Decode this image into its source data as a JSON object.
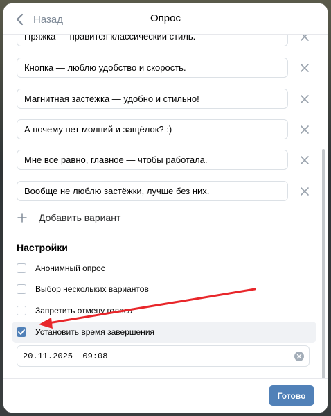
{
  "header": {
    "back_label": "Назад",
    "title": "Опрос"
  },
  "options": [
    "Пряжка — нравится классический стиль.",
    "Кнопка — люблю удобство и скорость.",
    "Магнитная застёжка — удобно и стильно!",
    "А почему нет молний и защёлок? :)",
    "Мне все равно, главное — чтобы работала.",
    "Вообще не люблю застёжки, лучше без них."
  ],
  "add_option_label": "Добавить вариант",
  "settings": {
    "title": "Настройки",
    "items": [
      {
        "label": "Анонимный опрос",
        "checked": false
      },
      {
        "label": "Выбор нескольких вариантов",
        "checked": false
      },
      {
        "label": "Запретить отмену голоса",
        "checked": false
      },
      {
        "label": "Установить время завершения",
        "checked": true
      }
    ]
  },
  "end_time": "20.11.2025  09:08",
  "footer": {
    "done_label": "Готово"
  },
  "colors": {
    "accent": "#5181b8",
    "annotation_arrow": "#e8262a"
  }
}
